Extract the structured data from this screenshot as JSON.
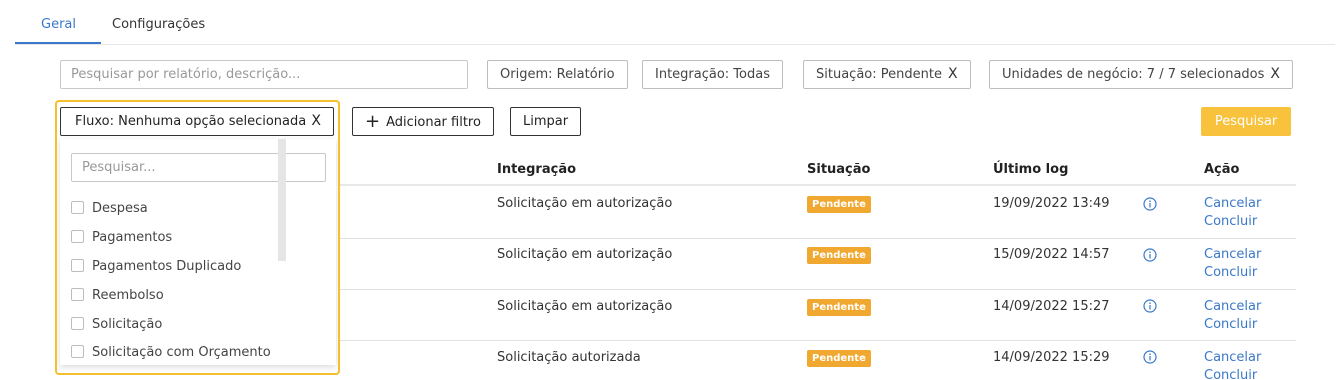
{
  "tabs": [
    {
      "label": "Geral"
    },
    {
      "label": "Configurações"
    }
  ],
  "filters": {
    "search_placeholder": "Pesquisar por relatório, descrição...",
    "chips": [
      {
        "label": "Origem: Relatório"
      },
      {
        "label": "Integração: Todas"
      },
      {
        "label": "Situação: Pendente"
      },
      {
        "label": "Unidades de negócio: 7 / 7 selecionados"
      }
    ],
    "fluxo_label": "Fluxo: Nenhuma opção selecionada",
    "add_filter_label": "Adicionar filtro",
    "clear_label": "Limpar",
    "search_button_label": "Pesquisar",
    "close_glyph": "X"
  },
  "dropdown": {
    "search_placeholder": "Pesquisar...",
    "options": [
      {
        "label": "Despesa"
      },
      {
        "label": "Pagamentos"
      },
      {
        "label": "Pagamentos Duplicado"
      },
      {
        "label": "Reembolso"
      },
      {
        "label": "Solicitação"
      },
      {
        "label": "Solicitação com Orçamento"
      }
    ]
  },
  "table": {
    "headers": {
      "integracao": "Integração",
      "situacao": "Situação",
      "ultimo_log": "Último log",
      "acao": "Ação"
    },
    "rows": [
      {
        "integracao": "Solicitação em autorização",
        "situacao": "Pendente",
        "ultimo_log": "19/09/2022 13:49",
        "acao1": "Cancelar",
        "acao2": "Concluir"
      },
      {
        "integracao": "Solicitação em autorização",
        "situacao": "Pendente",
        "ultimo_log": "15/09/2022 14:57",
        "acao1": "Cancelar",
        "acao2": "Concluir"
      },
      {
        "integracao": "Solicitação em autorização",
        "situacao": "Pendente",
        "ultimo_log": "14/09/2022 15:27",
        "acao1": "Cancelar",
        "acao2": "Concluir"
      },
      {
        "integracao": "Solicitação autorizada",
        "situacao": "Pendente",
        "ultimo_log": "14/09/2022 15:29",
        "acao1": "Cancelar",
        "acao2": "Concluir"
      }
    ]
  },
  "colors": {
    "accent": "#3a78c9",
    "highlight": "#f4c02e",
    "badge": "#f0a830",
    "primary_button": "#f9c23c"
  }
}
